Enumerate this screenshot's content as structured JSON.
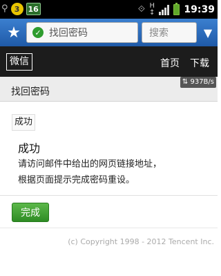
{
  "status_bar": {
    "badge_text": "3",
    "notification_count": "16",
    "network_label": "H",
    "clock": "19:39"
  },
  "browser": {
    "url_text": "找回密码",
    "search_placeholder": "搜索"
  },
  "site_header": {
    "logo": "微信",
    "nav": [
      "首页",
      "下载"
    ]
  },
  "page": {
    "title": "找回密码",
    "speed": "937B/s",
    "tag": "成功",
    "heading": "成功",
    "message_line1": "请访问邮件中给出的网页链接地址，",
    "message_line2": "根据页面提示完成密码重设。",
    "done_button": "完成",
    "copyright": "(c) Copyright 1998 - 2012 Tencent Inc."
  },
  "colors": {
    "url_bar": "#2d6cc0",
    "header_bg": "#1c1c1c",
    "done_button": "#3f9f32"
  }
}
